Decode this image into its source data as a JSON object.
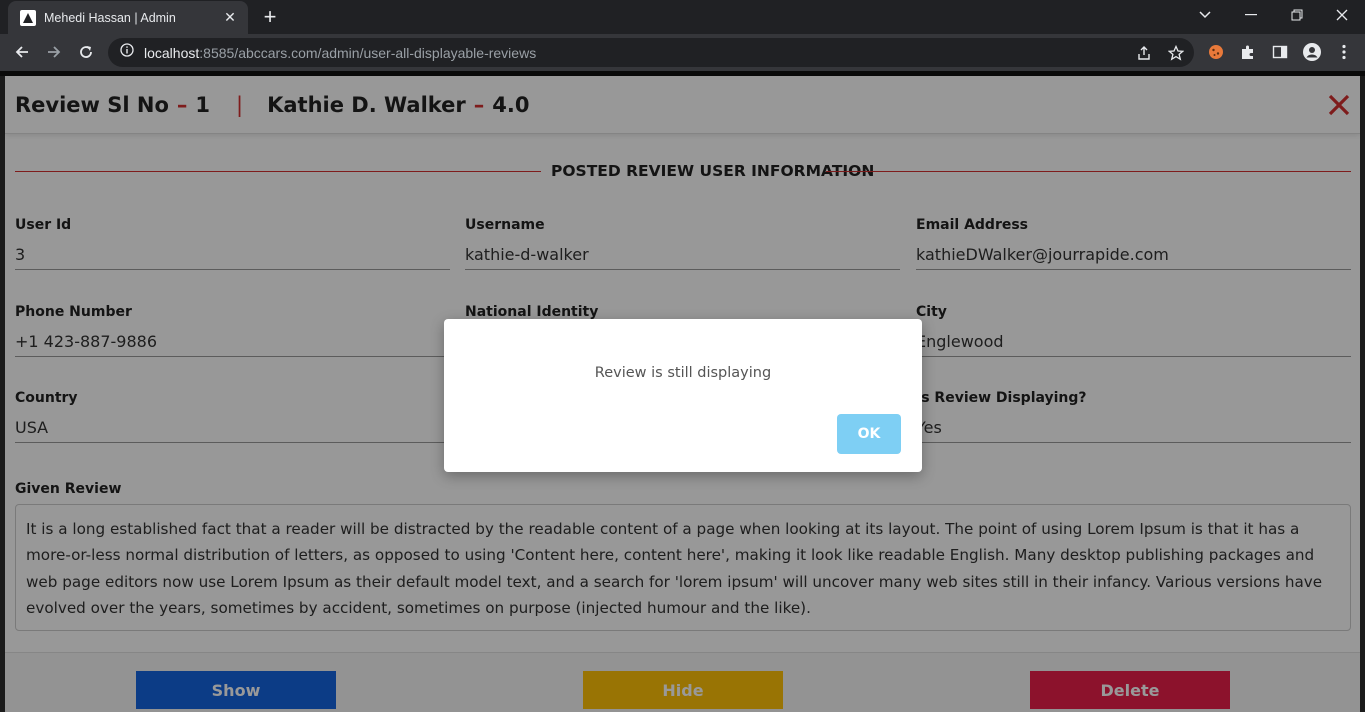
{
  "browser": {
    "tab_title": "Mehedi Hassan | Admin",
    "url_host": "localhost",
    "url_rest": ":8585/abccars.com/admin/user-all-displayable-reviews"
  },
  "modal": {
    "title_prefix": "Review Sl No",
    "serial": "1",
    "user_name": "Kathie D. Walker",
    "rating": "4.0",
    "dash": "–",
    "pipe": "|",
    "section_title": "POSTED REVIEW USER INFORMATION",
    "fields": [
      {
        "label": "User Id",
        "value": "3"
      },
      {
        "label": "Username",
        "value": "kathie-d-walker"
      },
      {
        "label": "Email Address",
        "value": "kathieDWalker@jourrapide.com"
      },
      {
        "label": "Phone Number",
        "value": "+1 423-887-9886"
      },
      {
        "label": "National Identity",
        "value": ""
      },
      {
        "label": "City",
        "value": "Englewood"
      },
      {
        "label": "Country",
        "value": "USA"
      },
      {
        "label": "",
        "value": ""
      },
      {
        "label": "Is Review Displaying?",
        "value": "Yes"
      }
    ],
    "review_label": "Given Review",
    "review_text": "It is a long established fact that a reader will be distracted by the readable content of a page when looking at its layout. The point of using Lorem Ipsum is that it has a more-or-less normal distribution of letters, as opposed to using 'Content here, content here', making it look like readable English. Many desktop publishing packages and web page editors now use Lorem Ipsum as their default model text, and a search for 'lorem ipsum' will uncover many web sites still in their infancy. Various versions have evolved over the years, sometimes by accident, sometimes on purpose (injected humour and the like).",
    "buttons": {
      "show": "Show",
      "hide": "Hide",
      "delete": "Delete"
    }
  },
  "dialog": {
    "message": "Review is still displaying",
    "ok": "OK"
  },
  "colors": {
    "accent_red": "#d32f2f",
    "show_button": "#1565e0",
    "hide_button": "#ffc107",
    "delete_button": "#e91e4a",
    "ok_button": "#7ecff4"
  }
}
